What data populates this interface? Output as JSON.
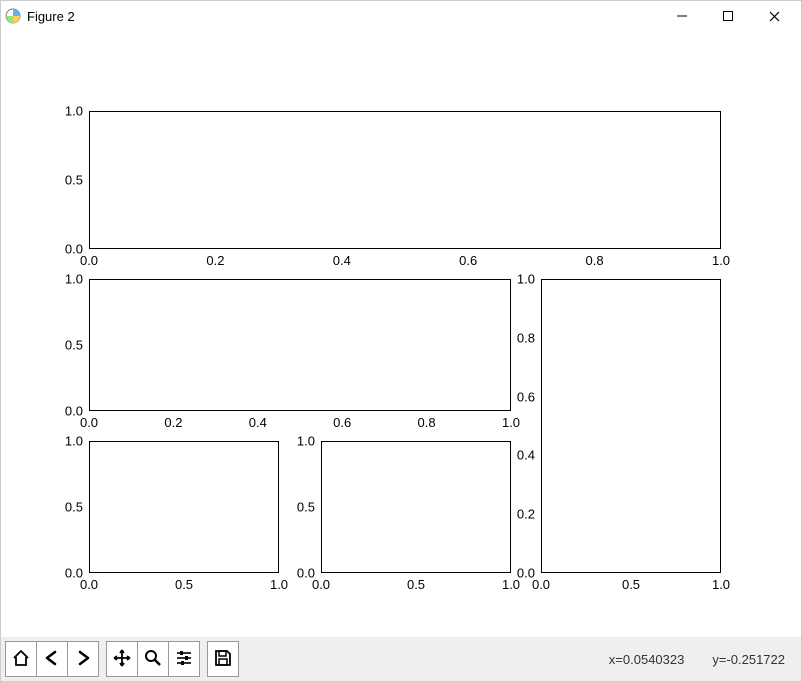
{
  "window": {
    "title": "Figure 2"
  },
  "toolbar": {
    "home": "Home",
    "back": "Back",
    "forward": "Forward",
    "pan": "Pan",
    "zoom": "Zoom",
    "configure": "Configure",
    "save": "Save"
  },
  "status": {
    "x_label": "x=0.0540323",
    "y_label": "y=-0.251722"
  },
  "chart_data": [
    {
      "type": "line",
      "index": 0,
      "name": "subplot-top",
      "gridspec": "row 0, all columns",
      "xlim": [
        0.0,
        1.0
      ],
      "ylim": [
        0.0,
        1.0
      ],
      "xticks": [
        0.0,
        0.2,
        0.4,
        0.6,
        0.8,
        1.0
      ],
      "yticks": [
        0.0,
        0.5,
        1.0
      ],
      "series": [],
      "title": "",
      "xlabel": "",
      "ylabel": ""
    },
    {
      "type": "line",
      "index": 1,
      "name": "subplot-middle-left",
      "gridspec": "row 1, columns 0-1",
      "xlim": [
        0.0,
        1.0
      ],
      "ylim": [
        0.0,
        1.0
      ],
      "xticks": [
        0.0,
        0.2,
        0.4,
        0.6,
        0.8,
        1.0
      ],
      "yticks": [
        0.0,
        0.5,
        1.0
      ],
      "series": [],
      "title": "",
      "xlabel": "",
      "ylabel": ""
    },
    {
      "type": "line",
      "index": 2,
      "name": "subplot-right-tall",
      "gridspec": "rows 1-2, column 2",
      "xlim": [
        0.0,
        1.0
      ],
      "ylim": [
        0.0,
        1.0
      ],
      "xticks": [
        0.0,
        0.5,
        1.0
      ],
      "yticks": [
        0.0,
        0.2,
        0.4,
        0.6,
        0.8,
        1.0
      ],
      "series": [],
      "title": "",
      "xlabel": "",
      "ylabel": ""
    },
    {
      "type": "line",
      "index": 3,
      "name": "subplot-bottom-left",
      "gridspec": "row 2, column 0",
      "xlim": [
        0.0,
        1.0
      ],
      "ylim": [
        0.0,
        1.0
      ],
      "xticks": [
        0.0,
        0.5,
        1.0
      ],
      "yticks": [
        0.0,
        0.5,
        1.0
      ],
      "series": [],
      "title": "",
      "xlabel": "",
      "ylabel": ""
    },
    {
      "type": "line",
      "index": 4,
      "name": "subplot-bottom-center",
      "gridspec": "row 2, column 1",
      "xlim": [
        0.0,
        1.0
      ],
      "ylim": [
        0.0,
        1.0
      ],
      "xticks": [
        0.0,
        0.5,
        1.0
      ],
      "yticks": [
        0.0,
        0.5,
        1.0
      ],
      "series": [],
      "title": "",
      "xlabel": "",
      "ylabel": ""
    }
  ]
}
